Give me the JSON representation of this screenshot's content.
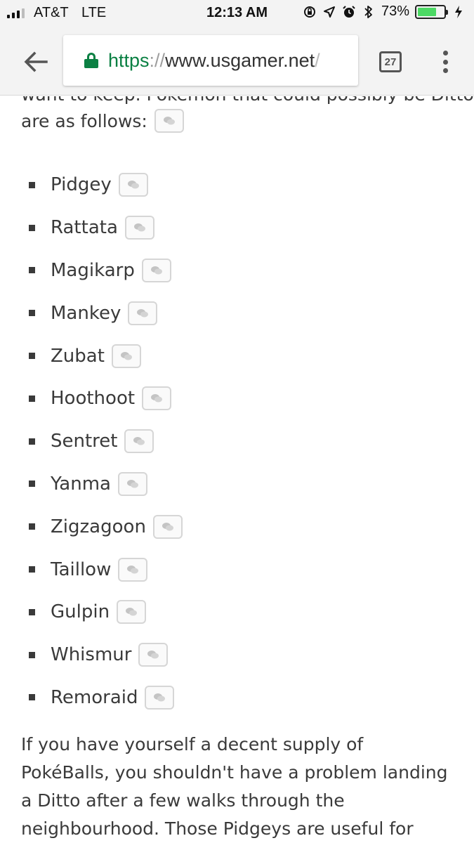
{
  "status_bar": {
    "carrier": "AT&T",
    "network": "LTE",
    "time": "12:13 AM",
    "battery_percent": "73%",
    "battery_level": 0.73,
    "icons": [
      "screen-rotation-lock-icon",
      "location-arrow-icon",
      "alarm-icon",
      "bluetooth-icon",
      "charging-bolt-icon"
    ]
  },
  "browser": {
    "url_scheme": "https",
    "url_separator": "://",
    "url_host": "www.usgamer.net",
    "url_overflow": "/",
    "tab_count": "27",
    "colors": {
      "secure": "#0b8043"
    }
  },
  "article": {
    "cut_off_line": "want to keep. Pokémon that could possibly be Ditto",
    "intro": "are as follows:",
    "items": [
      "Pidgey",
      "Rattata",
      "Magikarp",
      "Mankey",
      "Zubat",
      "Hoothoot",
      "Sentret",
      "Yanma",
      "Zigzagoon",
      "Taillow",
      "Gulpin",
      "Whismur",
      "Remoraid"
    ],
    "paragraph": "If you have yourself a decent supply of PokéBalls, you shouldn't have a problem landing a Ditto after a few walks through the neighbourhood. Those Pidgeys are useful for gaining experience, so get"
  }
}
